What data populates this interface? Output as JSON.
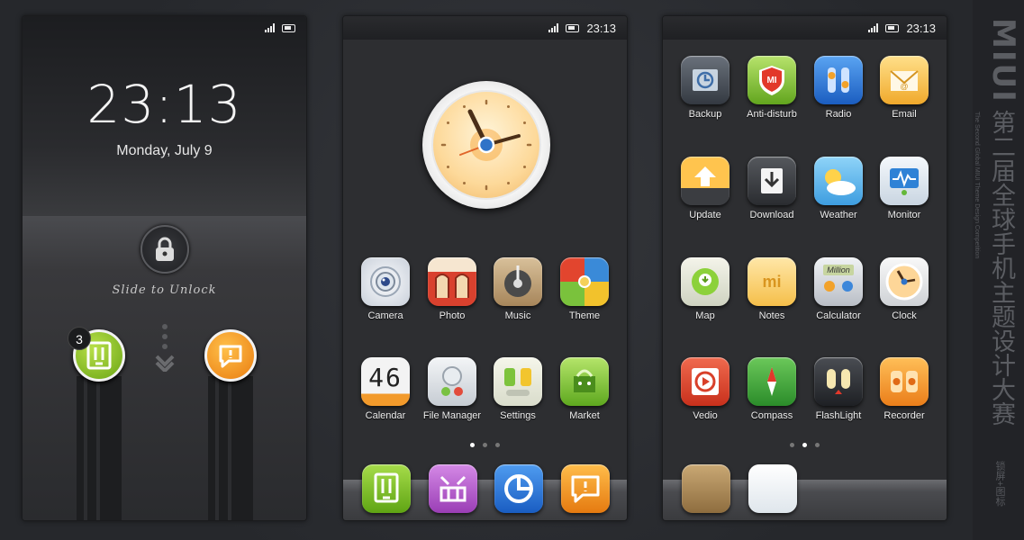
{
  "status": {
    "time": "23:13"
  },
  "lockscreen": {
    "time": "23:13",
    "date": "Monday, July 9",
    "slide_text": "Slide to Unlock",
    "badge_count": "3",
    "left_app_icon": "messages-icon",
    "right_app_icon": "chat-bubble-icon"
  },
  "home1": {
    "widget": "analog-clock",
    "apps": [
      {
        "label": "Camera",
        "icon": "camera-icon",
        "color": "#e8ecf2"
      },
      {
        "label": "Photo",
        "icon": "photo-icon",
        "color": "#d9412e"
      },
      {
        "label": "Music",
        "icon": "music-icon",
        "color": "#c9ad84"
      },
      {
        "label": "Theme",
        "icon": "theme-icon",
        "color": "#e55f31"
      },
      {
        "label": "Calendar",
        "icon": "calendar-icon",
        "color": "#f4f4f4"
      },
      {
        "label": "File Manager",
        "icon": "file-manager-icon",
        "color": "#e4e7ea"
      },
      {
        "label": "Settings",
        "icon": "settings-icon",
        "color": "#f2f2e4"
      },
      {
        "label": "Market",
        "icon": "market-icon",
        "color": "#8cd13a"
      }
    ],
    "calendar_digits": "46",
    "dock": [
      {
        "icon": "messages-icon",
        "color": "#86c428"
      },
      {
        "icon": "contacts-icon",
        "color": "#b260c9"
      },
      {
        "icon": "browser-icon",
        "color": "#2d7ce0"
      },
      {
        "icon": "chat-bubble-icon",
        "color": "#f49b26"
      }
    ],
    "page_dots": [
      true,
      false,
      false
    ]
  },
  "home2": {
    "apps": [
      {
        "label": "Backup",
        "icon": "backup-icon",
        "color": "#49505a"
      },
      {
        "label": "Anti-disturb",
        "icon": "anti-disturb-icon",
        "color": "#8fcc3a"
      },
      {
        "label": "Radio",
        "icon": "radio-icon",
        "color": "#3b87de"
      },
      {
        "label": "Email",
        "icon": "email-icon",
        "color": "#f7c84a"
      },
      {
        "label": "Update",
        "icon": "update-icon",
        "color": "#f4a025"
      },
      {
        "label": "Download",
        "icon": "download-icon",
        "color": "#3c3e42"
      },
      {
        "label": "Weather",
        "icon": "weather-icon",
        "color": "#6ec0ee"
      },
      {
        "label": "Monitor",
        "icon": "monitor-icon",
        "color": "#e8eef4"
      },
      {
        "label": "Map",
        "icon": "map-icon",
        "color": "#8bcf38"
      },
      {
        "label": "Notes",
        "icon": "notes-icon",
        "color": "#f7d57a"
      },
      {
        "label": "Calculator",
        "icon": "calculator-icon",
        "color": "#e2e4e8"
      },
      {
        "label": "Clock",
        "icon": "clock-icon",
        "color": "#f1f1f1"
      },
      {
        "label": "Vedio",
        "icon": "video-icon",
        "color": "#e04a30"
      },
      {
        "label": "Compass",
        "icon": "compass-icon",
        "color": "#49b03c"
      },
      {
        "label": "FlashLight",
        "icon": "flashlight-icon",
        "color": "#2e3035"
      },
      {
        "label": "Recorder",
        "icon": "recorder-icon",
        "color": "#f39a2d"
      }
    ],
    "notes_text": "mi",
    "calculator_text": "Million",
    "dock": [
      {
        "icon": "folder-icon",
        "color": "#b18f5f"
      },
      {
        "icon": "blank-app-icon",
        "color": "#eef2f5"
      }
    ],
    "page_dots": [
      false,
      true,
      false
    ]
  },
  "sidebar": {
    "brand": "MIUI",
    "subtitle_cn": "第二届全球手机主题设计大赛",
    "subtitle_en": "The Second Global MIUI Theme Design Competition",
    "note_cn": "锁屏+图标"
  }
}
